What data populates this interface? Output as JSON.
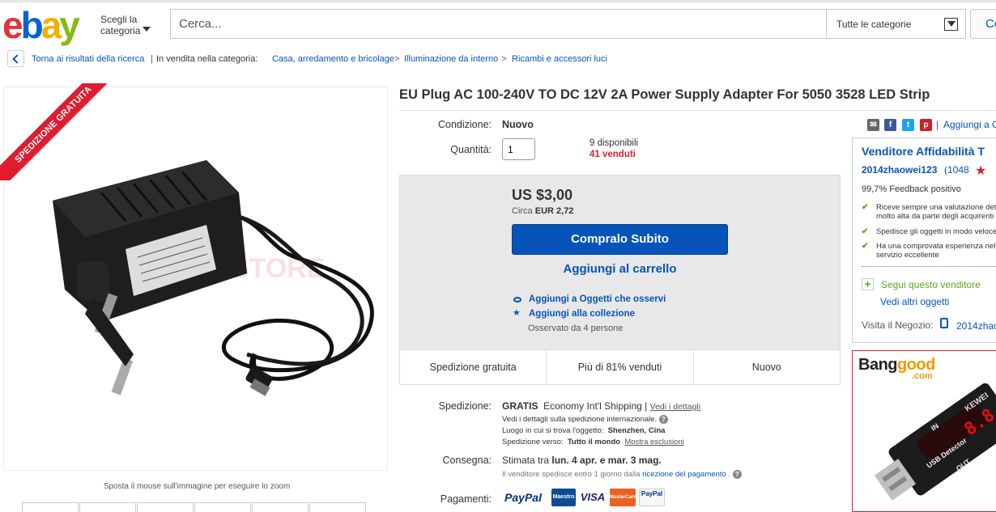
{
  "header": {
    "shop_by_category": "Scegli la categoria",
    "search_placeholder": "Cerca...",
    "category_select": "Tutte le categorie",
    "search_button": "Ce"
  },
  "breadcrumb": {
    "back_label": "Torna ai risultati della ricerca",
    "listed_in": "In vendita nella categoria:",
    "items": [
      "Casa, arredamento e bricolage",
      "Illuminazione da interno",
      "Ricambi e accessori luci"
    ]
  },
  "gallery": {
    "ribbon": "SPEDIZIONE GRATUITA",
    "zoom_hint": "Sposta il mouse sull'immagine per eseguire lo zoom"
  },
  "item": {
    "title": "EU Plug AC 100-240V TO DC 12V 2A Power Supply Adapter For 5050 3528 LED Strip",
    "condition_label": "Condizione:",
    "condition_value": "Nuovo",
    "quantity_label": "Quantità:",
    "quantity_value": "1",
    "available": "9 disponibili",
    "sold": "41 venduti"
  },
  "purchase": {
    "price": "US $3,00",
    "approx_prefix": "Circa",
    "approx_value": "EUR 2,72",
    "buy_now": "Compralo Subito",
    "add_to_cart": "Aggiungi al carrello",
    "watch": "Aggiungi a Oggetti che osservi",
    "collection": "Aggiungi alla collezione",
    "watchers": "Osservato da 4 persone"
  },
  "highlights": [
    "Spedizione gratuita",
    "Più di 81% venduti",
    "Nuovo"
  ],
  "shipping": {
    "label": "Spedizione:",
    "free": "GRATIS",
    "service": "Economy Int'l Shipping",
    "sep": "|",
    "details_link": "Vedi i dettagli",
    "intl_note": "Vedi i dettagli sulla spedizione internazionale.",
    "location_label": "Luogo in cui si trova l'oggetto:",
    "location_value": "Shenzhen, Cina",
    "ships_to_label": "Spedizione verso:",
    "ships_to_value": "Tutto il mondo",
    "exclusions_link": "Mostra esclusioni"
  },
  "delivery": {
    "label": "Consegna:",
    "prefix": "Stimata tra",
    "dates": "lun. 4 apr. e mar. 3 mag.",
    "note_prefix": "Il venditore spedisce entro 1 giorno dalla",
    "note_link": "ricezione del pagamento",
    "note_suffix": "."
  },
  "payments": {
    "label": "Pagamenti:",
    "paypal": "PayPal",
    "maestro": "Maestro",
    "visa": "VISA",
    "mastercard": "MasterCard",
    "paypal_credit": "PayPal"
  },
  "share": {
    "sep": "|",
    "add_to": "Aggiungi a O"
  },
  "seller": {
    "title": "Venditore Affidabilità T",
    "name": "2014zhaowei123",
    "score": "(1048",
    "feedback": "99,7% Feedback positivo",
    "bullets": [
      [
        "Riceve sempre una valutazione det",
        "molto alta da parte degli acquirenti"
      ],
      [
        "Spedisce gli oggetti in modo veloce"
      ],
      [
        "Ha una comprovata esperienza nel",
        "servizio eccellente"
      ]
    ],
    "follow": "Segui questo venditore",
    "more_items": "Vedi altri oggetti",
    "store_label": "Visita il Negozio:",
    "store_name": "2014zhao"
  },
  "ad": {
    "logo_bang": "Bang",
    "logo_good": "good",
    "logo_com": ".com",
    "device_text_1": "KEWEI",
    "device_text_2": "USB Detector",
    "device_text_3": "OUT",
    "device_text_4": "IN"
  },
  "colors": {
    "ebay_red": "#e53238",
    "ebay_blue": "#0064d2",
    "ebay_yellow": "#f5af02",
    "ebay_green": "#86b817",
    "link_blue": "#0654ba",
    "sold_red": "#dd1e31"
  }
}
